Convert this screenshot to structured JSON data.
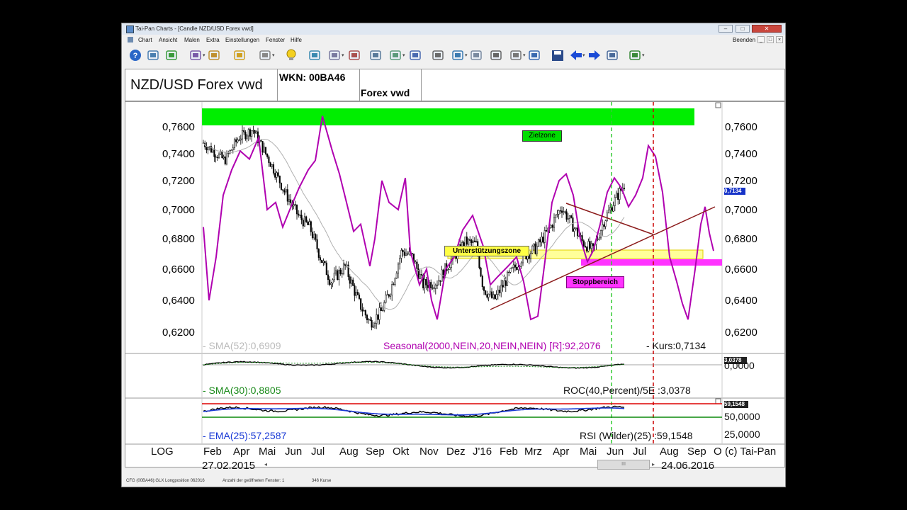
{
  "window": {
    "title": "Tai-Pan  Charts - [Candle NZD/USD Forex vwd]",
    "close_all_label": "Beenden"
  },
  "menu": [
    "Chart",
    "Ansicht",
    "Malen",
    "Extra",
    "Einstellungen",
    "Fenster",
    "Hilfe"
  ],
  "toolbar_icons": [
    "help-icon",
    "open-chart-icon",
    "book-icon",
    "chart-settings-icon",
    "draw-icon",
    "folder-icon",
    "brush-icon",
    "lightbulb-icon",
    "indicator-icon",
    "network-icon",
    "scissors-icon",
    "tools-icon",
    "table-icon",
    "window-icon",
    "print-icon",
    "layers-icon",
    "database-icon",
    "calculator-icon",
    "calculator2-icon",
    "monitor-icon",
    "save-icon",
    "arrow-left-icon",
    "arrow-right-icon",
    "export-icon",
    "exit-icon"
  ],
  "header": {
    "instrument": "NZD/USD Forex vwd",
    "wkn": "WKN: 00BA46",
    "exchange": "Forex vwd"
  },
  "main_chart": {
    "y_ticks": [
      "0,7600",
      "0,7400",
      "0,7200",
      "0,7000",
      "0,6800",
      "0,6600",
      "0,6400",
      "0,6200"
    ],
    "y_values": [
      0.76,
      0.74,
      0.72,
      0.7,
      0.68,
      0.66,
      0.64,
      0.62
    ],
    "current_badge": "0,7134",
    "zones": {
      "target": "Zielzone",
      "support": "Unterstützungszone",
      "stop": "Stoppbereich"
    },
    "sma_label": "- SMA(52):0,6909",
    "seasonal_label": "Seasonal(2000,NEIN,20,NEIN,NEIN) [R]:92,2076",
    "price_label": "- Kurs:0,7134",
    "colors": {
      "candles": "#000000",
      "sma": "#b0b0b0",
      "seasonal": "#b000b0",
      "target": "#00ee00",
      "support": "#ffff66",
      "stop": "#ff33ff",
      "trend": "#8b1a1a",
      "green_line": "#33cc33",
      "red_line": "#cc0000"
    }
  },
  "roc_panel": {
    "badge": "3,0378",
    "y_tick": "0,0000",
    "sma_label": "- SMA(30):0,8805",
    "roc_label": "ROC(40,Percent)/5E :3,0378"
  },
  "rsi_panel": {
    "badge": "59,1548",
    "y_ticks": [
      "50,0000",
      "25,0000"
    ],
    "ema_label": "- EMA(25):57,2587",
    "rsi_label": "RSI (Wilder)(25) :59,1548"
  },
  "x_axis": {
    "scale_label": "LOG",
    "months": [
      "Feb",
      "Apr",
      "Mai",
      "Jun",
      "Jul",
      "Aug",
      "Sep",
      "Okt",
      "Nov",
      "Dez",
      "J'16",
      "Feb",
      "Mrz",
      "Apr",
      "Mai",
      "Jun",
      "Jul",
      "Aug",
      "Sep",
      "O"
    ],
    "copyright": "(c) Tai-Pan",
    "start_date": "27.02.2015",
    "end_date": "24.06.2016"
  },
  "status": {
    "left": "CFG (00BA46):GLX Longposition 062016",
    "windows": "Anzahl der geöffneten Fenster: 1",
    "count": "346 Kurse"
  }
}
